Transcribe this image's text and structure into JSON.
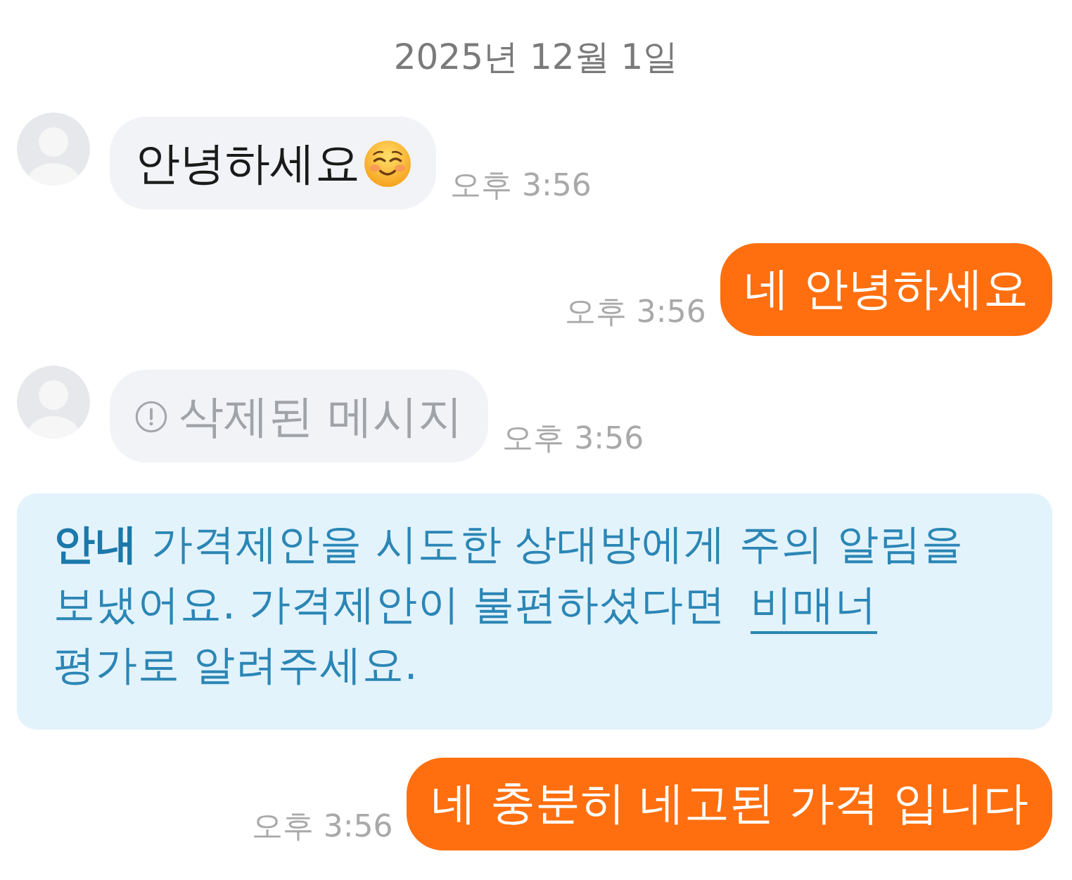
{
  "date_divider": "2025년 12월 1일",
  "messages": [
    {
      "kind": "incoming",
      "text": "안녕하세요",
      "emoji": true,
      "deleted": false,
      "time": "오후 3:56"
    },
    {
      "kind": "outgoing",
      "text": "네 안녕하세요",
      "emoji": false,
      "deleted": false,
      "time": "오후 3:56"
    },
    {
      "kind": "incoming",
      "text": "삭제된 메시지",
      "emoji": false,
      "deleted": true,
      "time": "오후 3:56"
    },
    {
      "kind": "notice",
      "text": "**안내** 가격제안을 시도한 상대방에게 주의 알림을 보냈어요. 가격제안이 불편하셨다면",
      "link": "비매너",
      "text_after": "평가로 알려주세요."
    },
    {
      "kind": "outgoing",
      "text": "네 충분히 네고된 가격 입니다",
      "emoji": false,
      "deleted": false,
      "time": "오후 3:56"
    }
  ]
}
